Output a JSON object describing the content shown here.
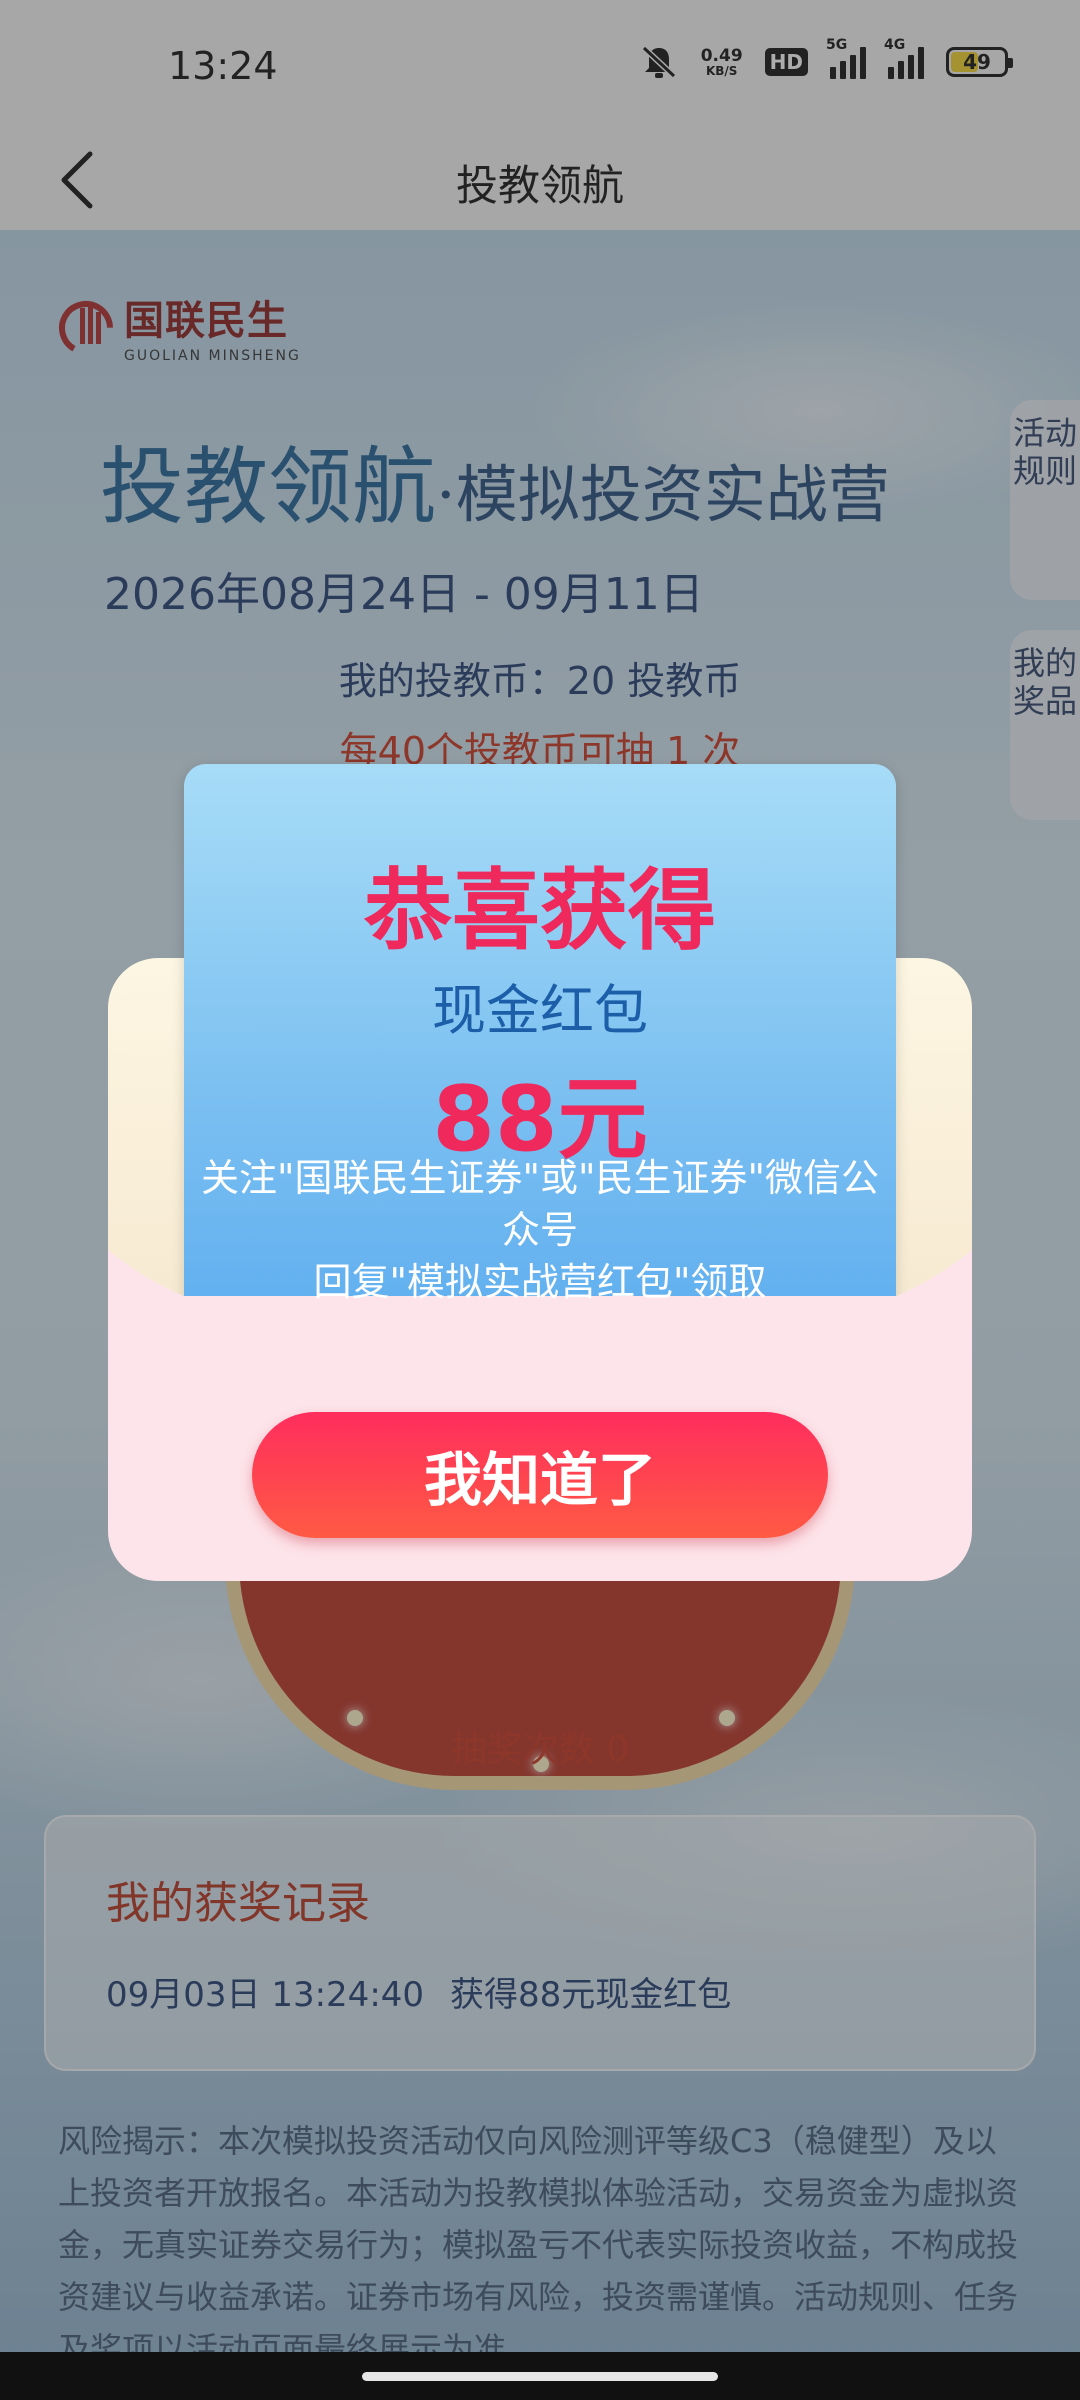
{
  "status_bar": {
    "time": "13:24",
    "speed_value": "0.49",
    "speed_unit": "KB/S",
    "hd_label": "HD",
    "network_1": "5G",
    "network_2": "4G",
    "battery_level": "49",
    "battery_fill_fraction": 0.49,
    "icons": [
      "mute-icon",
      "signal-5g-icon",
      "signal-4g-icon",
      "battery-icon"
    ]
  },
  "titlebar": {
    "back_icon": "chevron-left-icon",
    "title": "投教领航"
  },
  "page": {
    "logo_text": "国联民生",
    "logo_sub": "GUOLIAN MINSHENG",
    "hero_title_main": "投教领航",
    "hero_title_sub": "·模拟投资实战营",
    "dates": "2026年08月24日 - 09月11日",
    "coins": "我的投教币：20 投教币",
    "draw_rule": "每40个投教币可抽 1 次",
    "side_tab_rules": "活动规则",
    "side_tab_prizes": "我的奖品",
    "draw_count": "抽奖次数 0",
    "records_title": "我的获奖记录",
    "record_time": "09月03日 13:24:40",
    "record_desc": "获得88元现金红包",
    "risk_text": "风险揭示：本次模拟投资活动仅向风险测评等级C3（稳健型）及以上投资者开放报名。本活动为投教模拟体验活动，交易资金为虚拟资金，无真实证券交易行为；模拟盈亏不代表实际投资收益，不构成投资建议与收益承诺。证券市场有风险，投资需谨慎。活动规则、任务及奖项以活动页面最终展示为准"
  },
  "modal": {
    "congrats": "恭喜获得",
    "prize_name": "现金红包",
    "prize_amount": "88元",
    "instruction_line1": "关注\"国联民生证券\"或\"民生证券\"微信公众号",
    "instruction_line2": "回复\"模拟实战营红包\"领取",
    "ok_button": "我知道了"
  },
  "colors": {
    "accent_red": "#f0295c",
    "button_gradient_start": "#ff2d5e",
    "button_gradient_end": "#ff5a43",
    "card_blue": "#7cc0f1",
    "title_blue": "#1d5f93",
    "warning_red": "#c9331e"
  }
}
